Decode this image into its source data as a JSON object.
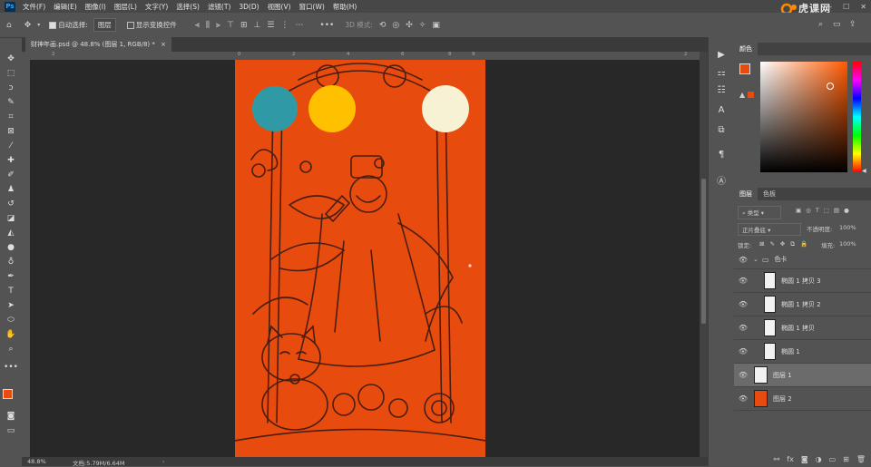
{
  "app": {
    "logo": "Ps"
  },
  "menu": [
    "文件(F)",
    "编辑(E)",
    "图像(I)",
    "图层(L)",
    "文字(Y)",
    "选择(S)",
    "滤镜(T)",
    "3D(D)",
    "视图(V)",
    "窗口(W)",
    "帮助(H)"
  ],
  "watermark": {
    "text": "虎课网"
  },
  "window_controls": [
    "—",
    "☐",
    "✕"
  ],
  "options": {
    "auto_select_label": "自动选择:",
    "auto_select_value": "图层",
    "show_transform_label": "显示变换控件",
    "mode_3d_label": "3D 模式:"
  },
  "document_tab": {
    "title": "财神年画.psd @ 48.8% (图层 1, RGB/8) *",
    "close": "×"
  },
  "ruler": {
    "top_ticks": [
      "2",
      "0",
      "2",
      "4",
      "6",
      "8",
      "9",
      "2"
    ]
  },
  "status": {
    "zoom": "48.8%",
    "doc": "文档:5.79M/6.64M"
  },
  "colors": {
    "canvas": "#e84b0e",
    "swatch_teal": "#2f9aa6",
    "swatch_yellow": "#ffc000",
    "swatch_cream": "#f7f2d4",
    "foreground": "#e84b0e",
    "background": "#f0f0f0",
    "accent": "#31a8ff"
  },
  "color_panel": {
    "tab": "颜色"
  },
  "layers_panel": {
    "tabs": [
      "图层",
      "色板"
    ],
    "filter_label": "类型",
    "blend_mode": "正片叠底",
    "opacity_label": "不透明度:",
    "opacity_value": "100%",
    "lock_label": "锁定:",
    "fill_label": "填充:",
    "fill_value": "100%",
    "group_name": "色卡",
    "layers": [
      {
        "name": "椭圆 1 拷贝 3",
        "selected": false
      },
      {
        "name": "椭圆 1 拷贝 2",
        "selected": false
      },
      {
        "name": "椭圆 1 拷贝",
        "selected": false
      },
      {
        "name": "椭圆 1",
        "selected": false
      },
      {
        "name": "图层 1",
        "selected": true
      },
      {
        "name": "图层 2",
        "selected": false
      }
    ]
  }
}
